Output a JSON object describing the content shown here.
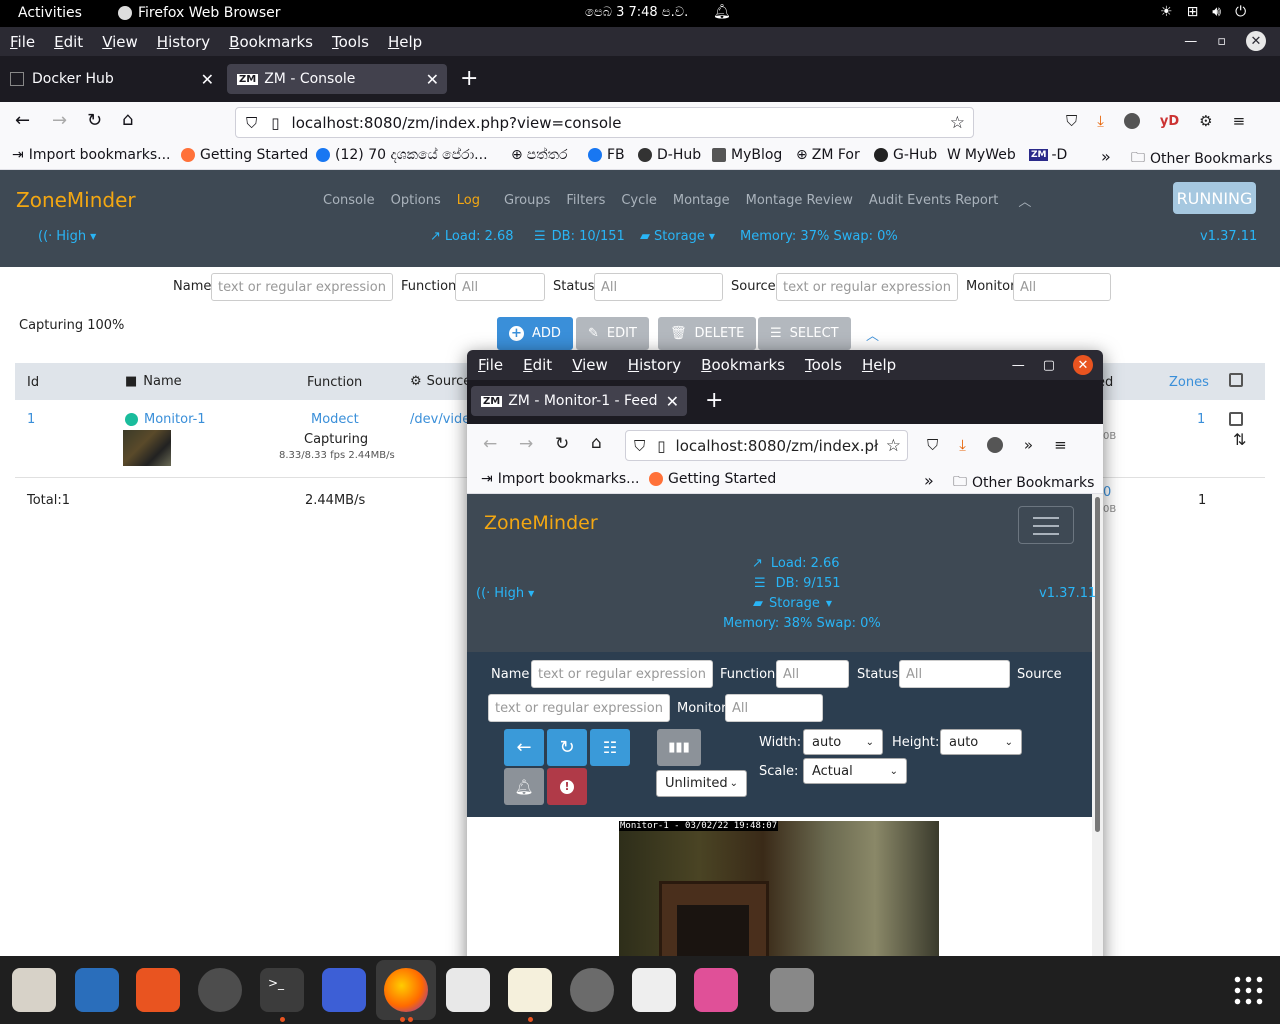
{
  "topbar": {
    "activities": "Activities",
    "app": "Firefox Web Browser",
    "clock": "පෙබ 3  7:48 ප.ව."
  },
  "menu": {
    "file": "File",
    "edit": "Edit",
    "view": "View",
    "history": "History",
    "bookmarks": "Bookmarks",
    "tools": "Tools",
    "help": "Help"
  },
  "tabs": [
    {
      "title": "Docker Hub"
    },
    {
      "title": "ZM - Console"
    }
  ],
  "url": "localhost:8080/zm/index.php?view=console",
  "bookmarks": {
    "import": "Import bookmarks...",
    "getting_started": "Getting Started",
    "fb_item": "(12) 70 දශකයේ පේරා...",
    "paththara": "පත්තර",
    "fb": "FB",
    "dhub": "D-Hub",
    "myblog": "MyBlog",
    "zmfor": "ZM For",
    "ghub": "G-Hub",
    "myweb": "MyWeb",
    "zmd": "-D",
    "other": "Other Bookmarks"
  },
  "zm": {
    "logo": "ZoneMinder",
    "nav": [
      "Console",
      "Options",
      "Log",
      "Groups",
      "Filters",
      "Cycle",
      "Montage",
      "Montage Review",
      "Audit Events Report"
    ],
    "status_button": "RUNNING",
    "bandwidth": "High",
    "load": "Load: 2.68",
    "db": "DB: 10/151",
    "storage": "Storage",
    "memory": "Memory: 37% Swap: 0%",
    "version": "v1.37.11",
    "filters": {
      "name_label": "Name",
      "name_ph": "text or regular expression",
      "function_label": "Function",
      "function_val": "All",
      "status_label": "Status",
      "status_val": "All",
      "source_label": "Source",
      "source_ph": "text or regular expression",
      "monitor_label": "Monitor",
      "monitor_val": "All"
    },
    "capturing": "Capturing 100%",
    "buttons": {
      "add": "ADD",
      "edit": "EDIT",
      "delete": "DELETE",
      "select": "SELECT"
    },
    "table": {
      "headers": {
        "id": "Id",
        "name": "Name",
        "function": "Function",
        "source": "Source",
        "events_tail": "ed",
        "zones": "Zones"
      },
      "row": {
        "id": "1",
        "name": "Monitor-1",
        "function": "Modect",
        "status": "Capturing",
        "fps": "8.33/8.33 fps 2.44MB/s",
        "source": "/dev/video",
        "zones": "1",
        "ev_partial": "0",
        "ev_size": "0B",
        "ev_size2": "0B"
      },
      "total": {
        "label": "Total:1",
        "bw": "2.44MB/s",
        "zones": "1"
      }
    }
  },
  "popup": {
    "tab_title": "ZM - Monitor-1 - Feed",
    "url": "localhost:8080/zm/index.pł",
    "bookmarks": {
      "import": "Import bookmarks...",
      "getting_started": "Getting Started",
      "other": "Other Bookmarks"
    },
    "zm": {
      "logo": "ZoneMinder",
      "load": "Load: 2.66",
      "db": "DB: 9/151",
      "storage": "Storage",
      "memory": "Memory: 38% Swap: 0%",
      "bandwidth": "High",
      "version": "v1.37.11",
      "filters": {
        "name_label": "Name",
        "name_ph": "text or regular expression",
        "function_label": "Function",
        "function_val": "All",
        "status_label": "Status",
        "status_val": "All",
        "source_label": "Source",
        "source_ph": "text or regular expression",
        "monitor_label": "Monitor",
        "monitor_val": "All"
      },
      "width_label": "Width:",
      "width_val": "auto",
      "height_label": "Height:",
      "height_val": "auto",
      "scale_label": "Scale:",
      "scale_val": "Actual",
      "rate_val": "Unlimited",
      "feed_overlay": "Monitor-1 - 03/02/22 19:48:07"
    }
  }
}
